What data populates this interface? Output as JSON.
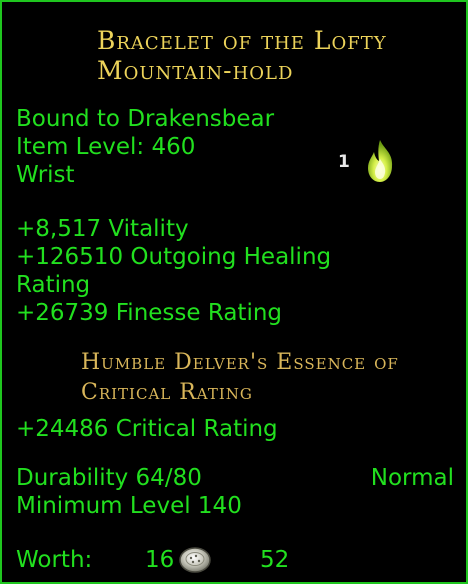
{
  "item": {
    "title": "Bracelet of the Lofty Mountain-hold",
    "bound": "Bound to Drakensbear",
    "item_level": "Item Level: 460",
    "slot": "Wrist",
    "essence_slots": "1",
    "stats": [
      "+8,517 Vitality",
      "+126510 Outgoing Healing",
      "Rating",
      "+26739 Finesse Rating"
    ],
    "essence": {
      "name": "Humble Delver's Essence of Critical Rating",
      "stat": "+24486 Critical Rating"
    },
    "durability": "Durability 64/80",
    "quality": "Normal",
    "min_level": "Minimum Level 140",
    "worth": {
      "label": "Worth:",
      "silver": "16",
      "copper": "52",
      "coin_icon": "silver-coin-icon"
    }
  },
  "colors": {
    "border": "#1fc61f",
    "stat_text": "#22e01f",
    "title_gold": "#ecd35a",
    "essence_gold": "#d9b65a"
  }
}
